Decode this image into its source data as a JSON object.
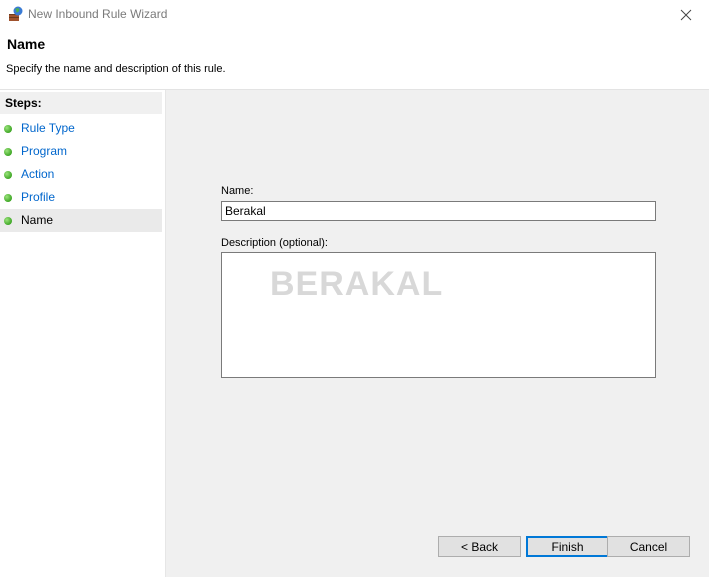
{
  "window": {
    "title": "New Inbound Rule Wizard",
    "icon": "firewall-globe-icon"
  },
  "header": {
    "heading": "Name",
    "subtitle": "Specify the name and description of this rule."
  },
  "steps": {
    "heading": "Steps:",
    "items": [
      {
        "label": "Rule Type",
        "current": false
      },
      {
        "label": "Program",
        "current": false
      },
      {
        "label": "Action",
        "current": false
      },
      {
        "label": "Profile",
        "current": false
      },
      {
        "label": "Name",
        "current": true
      }
    ]
  },
  "form": {
    "name_label": "Name:",
    "name_value": "Berakal",
    "description_label": "Description (optional):",
    "description_value": ""
  },
  "watermark": "BERAKAL",
  "buttons": {
    "back": "< Back",
    "finish": "Finish",
    "cancel": "Cancel"
  },
  "colors": {
    "link": "#0066cc",
    "step_dot": "#3fa726",
    "default_button_border": "#0078d7"
  }
}
